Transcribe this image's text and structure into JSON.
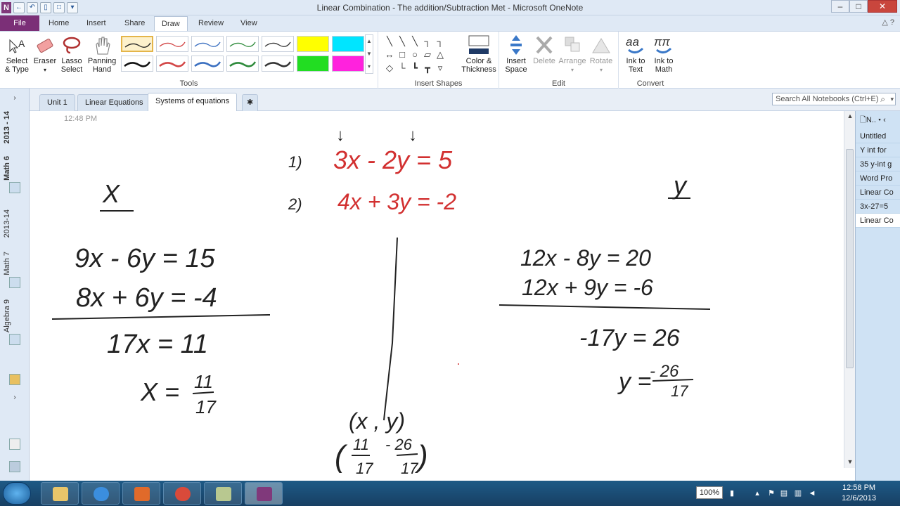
{
  "window": {
    "title": "Linear Combination -  The addition/Subtraction Met  -  Microsoft OneNote",
    "quick_access": {
      "app_letter": "N",
      "more_glyph": "▾"
    },
    "controls": {
      "minimize": "–",
      "maximize": "□",
      "close": "✕"
    }
  },
  "ribbon": {
    "file_tab": "File",
    "tabs": [
      "Home",
      "Insert",
      "Share",
      "Draw",
      "Review",
      "View"
    ],
    "active_tab": "Draw",
    "help": "△ ?",
    "groups": {
      "tools": {
        "label": "Tools",
        "select_type": [
          "Select",
          "& Type"
        ],
        "eraser": "Eraser",
        "lasso": [
          "Lasso",
          "Select"
        ],
        "panning": [
          "Panning",
          "Hand"
        ],
        "pen_colors": [
          "#222222",
          "#d24545",
          "#3a6fc0",
          "#2d8a3a",
          "#333333",
          "#111111",
          "#d24545",
          "#3a6fc0",
          "#2d8a3a",
          "#333333"
        ],
        "highlighter_colors": [
          "#ffff00",
          "#00e5ff",
          "#22dd22",
          "#ff22dd"
        ]
      },
      "insert_shapes": {
        "label": "Insert Shapes",
        "color_thickness": [
          "Color &",
          "Thickness"
        ]
      },
      "edit": {
        "label": "Edit",
        "insert_space": [
          "Insert",
          "Space"
        ],
        "delete": "Delete",
        "arrange": "Arrange",
        "rotate": "Rotate"
      },
      "convert": {
        "label": "Convert",
        "ink_to_text": [
          "Ink to",
          "Text"
        ],
        "ink_to_math": [
          "Ink to",
          "Math"
        ]
      }
    }
  },
  "sections": {
    "tabs": [
      "Unit 1",
      "Linear Equations",
      "Systems of equations"
    ],
    "active": "Systems of equations",
    "search_placeholder": "Search All Notebooks (Ctrl+E)"
  },
  "notebooks": [
    "2013 - 14",
    "Math 6",
    "2013-14",
    "Math 7",
    "Algebra 9"
  ],
  "page": {
    "timestamp": "12:48 PM",
    "ink": {
      "red_1": "3x - 2y = 5",
      "red_2": "4x  + 3y = -2",
      "label_1": "1)",
      "label_2": "2)",
      "x_head": "X",
      "y_head": "y",
      "left_1": "9x - 6y = 15",
      "left_2": "8x  + 6y = -4",
      "left_3": "17x = 11",
      "left_4": "X =",
      "left_4_num": "11",
      "left_4_den": "17",
      "right_1": "12x - 8y = 20",
      "right_2": "12x + 9y = -6",
      "right_3": "-17y = 26",
      "right_4": "y =",
      "right_4_num": "- 26",
      "right_4_den": "17",
      "pair": "(x , y)",
      "pair_vals_open": "(",
      "pair_vals_close": ")",
      "pair_x_num": "11",
      "pair_x_den": "17",
      "pair_y_num": "- 26",
      "pair_y_den": "17",
      "arrows": "↓"
    }
  },
  "pages_panel": {
    "header": "N..",
    "items": [
      "Untitled",
      "Y int for",
      "35 y-int g",
      "Word Pro",
      "Linear Co",
      "3x-27=5",
      "Linear Co"
    ],
    "selected_index": 6
  },
  "taskbar": {
    "zoom": "100%",
    "time": "12:58 PM",
    "date": "12/6/2013"
  }
}
